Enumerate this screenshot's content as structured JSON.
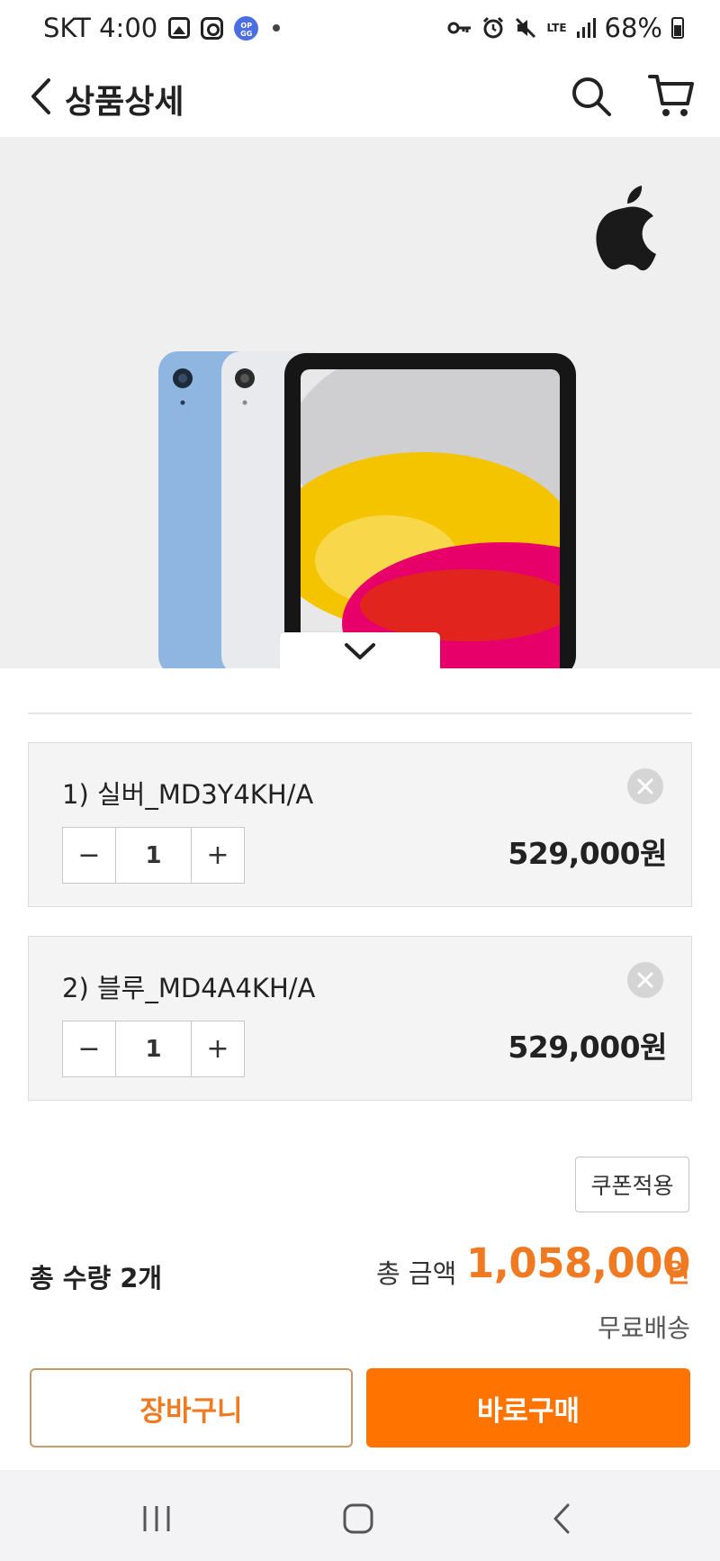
{
  "status_bar": {
    "carrier_time": "SKT 4:00",
    "opgg_badge": "OP GG",
    "network": "LTE",
    "battery": "68%"
  },
  "header": {
    "title": "상품상세"
  },
  "product_image": {
    "brand_icon": "apple-logo-icon",
    "colors": [
      "#8fb6e0",
      "#e9eaee",
      "#1c1c1c",
      "#f5c400",
      "#e8006a"
    ]
  },
  "options": [
    {
      "name": "1) 실버_MD3Y4KH/A",
      "quantity": "1",
      "price": "529,000원"
    },
    {
      "name": "2) 블루_MD4A4KH/A",
      "quantity": "1",
      "price": "529,000원"
    }
  ],
  "stepper": {
    "minus": "−",
    "plus": "+"
  },
  "coupon": {
    "label": "쿠폰적용"
  },
  "totals": {
    "quantity_text": "총 수량 2개",
    "amount_label": "총 금액",
    "amount": "1,058,000",
    "currency": "원",
    "shipping": "무료배송"
  },
  "actions": {
    "cart_label": "장바구니",
    "buy_label": "바로구매"
  },
  "theme": {
    "accent": "#ff7300",
    "accent_text": "#f07a22"
  }
}
